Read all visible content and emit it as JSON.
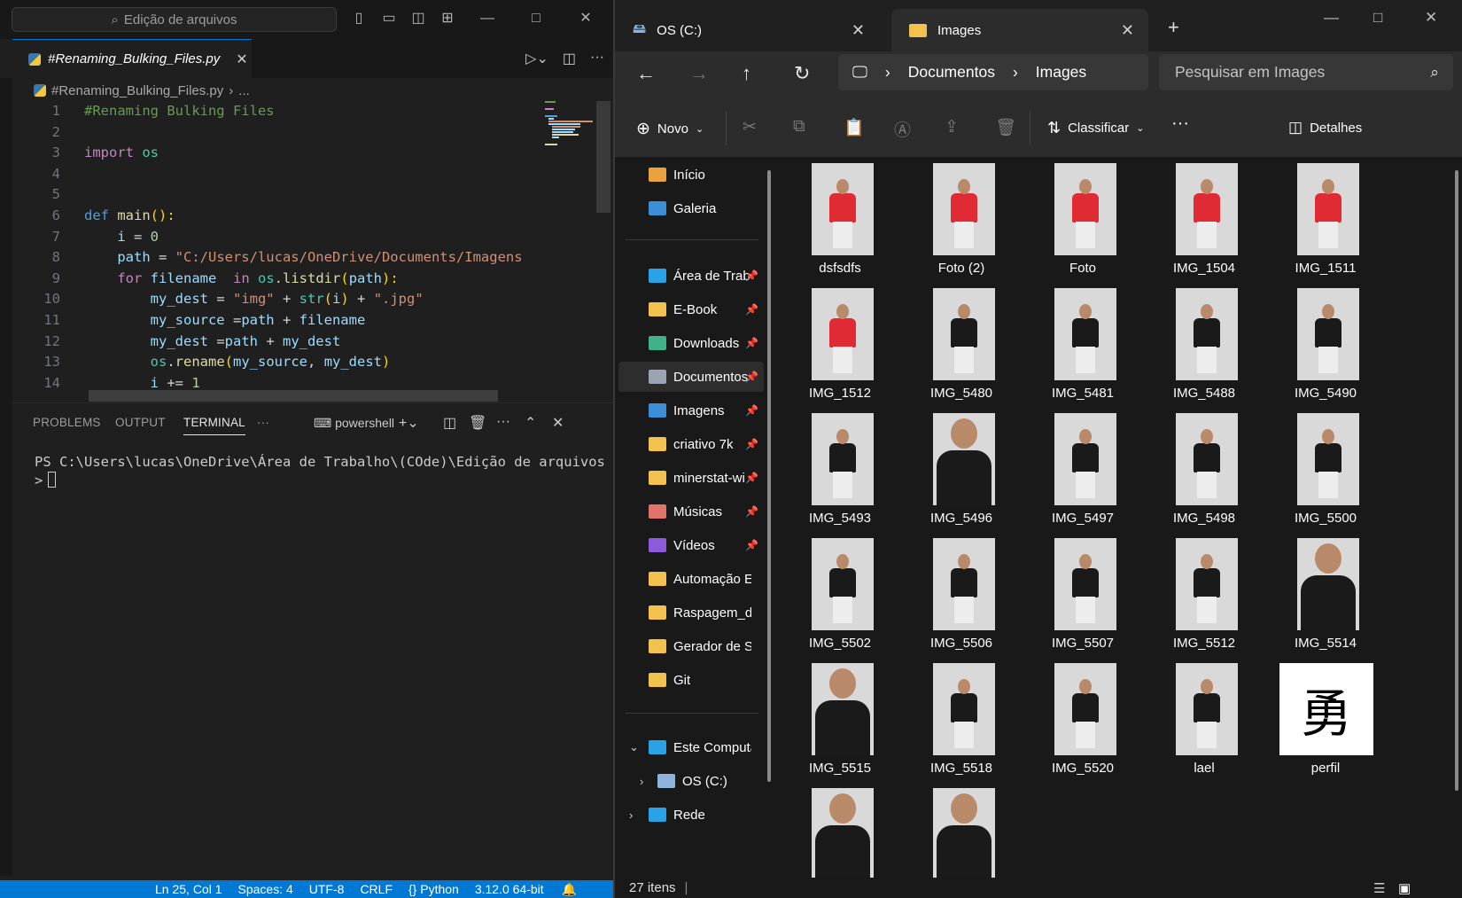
{
  "vscode": {
    "search_text": "Edição de arquivos",
    "tab_label": "#Renaming_Bulking_Files.py",
    "breadcrumb_file": "#Renaming_Bulking_Files.py",
    "breadcrumb_more": "...",
    "code_lines": [
      {
        "n": "1",
        "tokens": [
          {
            "t": "#Renaming Bulking Files",
            "c": "com"
          }
        ]
      },
      {
        "n": "2",
        "tokens": []
      },
      {
        "n": "3",
        "tokens": [
          {
            "t": "import",
            "c": "kw"
          },
          {
            "t": " os",
            "c": "mod"
          }
        ]
      },
      {
        "n": "4",
        "tokens": []
      },
      {
        "n": "5",
        "tokens": []
      },
      {
        "n": "6",
        "tokens": [
          {
            "t": "def",
            "c": "def"
          },
          {
            "t": " ",
            "c": ""
          },
          {
            "t": "main",
            "c": "fn"
          },
          {
            "t": "():",
            "c": "par"
          }
        ]
      },
      {
        "n": "7",
        "tokens": [
          {
            "t": "    i",
            "c": "var"
          },
          {
            "t": " = ",
            "c": ""
          },
          {
            "t": "0",
            "c": "num"
          }
        ]
      },
      {
        "n": "8",
        "tokens": [
          {
            "t": "    path",
            "c": "var"
          },
          {
            "t": " = ",
            "c": ""
          },
          {
            "t": "\"C:/Users/lucas/OneDrive/Documents/Imagens",
            "c": "str"
          }
        ]
      },
      {
        "n": "9",
        "tokens": [
          {
            "t": "    for",
            "c": "kw"
          },
          {
            "t": " filename",
            "c": "var"
          },
          {
            "t": "  in ",
            "c": "kw"
          },
          {
            "t": "os",
            "c": "mod"
          },
          {
            "t": ".",
            "c": ""
          },
          {
            "t": "listdir",
            "c": "fn"
          },
          {
            "t": "(",
            "c": "par"
          },
          {
            "t": "path",
            "c": "var"
          },
          {
            "t": "):",
            "c": "par"
          }
        ]
      },
      {
        "n": "10",
        "tokens": [
          {
            "t": "        my_dest",
            "c": "var"
          },
          {
            "t": " = ",
            "c": ""
          },
          {
            "t": "\"img\"",
            "c": "str"
          },
          {
            "t": " + ",
            "c": ""
          },
          {
            "t": "str",
            "c": "mod"
          },
          {
            "t": "(",
            "c": "par"
          },
          {
            "t": "i",
            "c": "var"
          },
          {
            "t": ")",
            "c": "par"
          },
          {
            "t": " + ",
            "c": ""
          },
          {
            "t": "\".jpg\"",
            "c": "str"
          }
        ]
      },
      {
        "n": "11",
        "tokens": [
          {
            "t": "        my_source",
            "c": "var"
          },
          {
            "t": " =",
            "c": ""
          },
          {
            "t": "path",
            "c": "var"
          },
          {
            "t": " + ",
            "c": ""
          },
          {
            "t": "filename",
            "c": "var"
          }
        ]
      },
      {
        "n": "12",
        "tokens": [
          {
            "t": "        my_dest",
            "c": "var"
          },
          {
            "t": " =",
            "c": ""
          },
          {
            "t": "path",
            "c": "var"
          },
          {
            "t": " + ",
            "c": ""
          },
          {
            "t": "my_dest",
            "c": "var"
          }
        ]
      },
      {
        "n": "13",
        "tokens": [
          {
            "t": "        os",
            "c": "mod"
          },
          {
            "t": ".",
            "c": ""
          },
          {
            "t": "rename",
            "c": "fn"
          },
          {
            "t": "(",
            "c": "par"
          },
          {
            "t": "my_source",
            "c": "var"
          },
          {
            "t": ", ",
            "c": ""
          },
          {
            "t": "my_dest",
            "c": "var"
          },
          {
            "t": ")",
            "c": "par"
          }
        ]
      },
      {
        "n": "14",
        "tokens": [
          {
            "t": "        i",
            "c": "var"
          },
          {
            "t": " += ",
            "c": ""
          },
          {
            "t": "1",
            "c": "num"
          }
        ]
      }
    ],
    "panel_tabs": {
      "problems": "PROBLEMS",
      "output": "OUTPUT",
      "terminal": "TERMINAL",
      "more": "···"
    },
    "shell_name": "powershell",
    "terminal_line1": "PS C:\\Users\\lucas\\OneDrive\\Área de Trabalho\\(COde)\\Edição de arquivos",
    "terminal_prompt": ">",
    "status": {
      "position": "Ln 25, Col 1",
      "spaces": "Spaces: 4",
      "encoding": "UTF-8",
      "eol": "CRLF",
      "language": "Python",
      "interpreter": "3.12.0 64-bit"
    }
  },
  "explorer": {
    "tabs": [
      {
        "label": "OS (C:)",
        "icon": "drive-icon"
      },
      {
        "label": "Images",
        "icon": "folder-icon"
      }
    ],
    "breadcrumb": [
      "Documentos",
      "Images"
    ],
    "search_placeholder": "Pesquisar em Images",
    "commands": {
      "new": "Novo",
      "sort": "Classificar",
      "more": "···",
      "details": "Detalhes"
    },
    "sidebar": [
      {
        "label": "Início",
        "icon": "home-icon",
        "color": "#e8a33d",
        "pin": false
      },
      {
        "label": "Galeria",
        "icon": "gallery-icon",
        "color": "#3a8fd6",
        "pin": false
      },
      {
        "label": "Área de Trab",
        "icon": "desktop-icon",
        "color": "#2aa3e6",
        "pin": true
      },
      {
        "label": "E-Book",
        "icon": "folder-icon",
        "color": "#f2c14e",
        "pin": true
      },
      {
        "label": "Downloads",
        "icon": "download-icon",
        "color": "#3fb28a",
        "pin": true
      },
      {
        "label": "Documentos",
        "icon": "document-icon",
        "color": "#9aa4b2",
        "pin": true
      },
      {
        "label": "Imagens",
        "icon": "pictures-icon",
        "color": "#3a8fd6",
        "pin": true
      },
      {
        "label": "criativo 7k",
        "icon": "folder-icon",
        "color": "#f2c14e",
        "pin": true
      },
      {
        "label": "minerstat-wi",
        "icon": "folder-icon",
        "color": "#f2c14e",
        "pin": true
      },
      {
        "label": "Músicas",
        "icon": "music-icon",
        "color": "#e0746a",
        "pin": true
      },
      {
        "label": "Vídeos",
        "icon": "video-icon",
        "color": "#8c5bd9",
        "pin": true
      },
      {
        "label": "Automação E-m",
        "icon": "folder-icon",
        "color": "#f2c14e",
        "pin": false
      },
      {
        "label": "Raspagem_de_[",
        "icon": "folder-icon",
        "color": "#f2c14e",
        "pin": false
      },
      {
        "label": "Gerador de Sen",
        "icon": "folder-icon",
        "color": "#f2c14e",
        "pin": false
      },
      {
        "label": "Git",
        "icon": "folder-icon",
        "color": "#f2c14e",
        "pin": false
      },
      {
        "label": "Este Computad",
        "icon": "computer-icon",
        "color": "#2aa3e6",
        "pin": false
      },
      {
        "label": "OS (C:)",
        "icon": "drive-icon",
        "color": "#8fb4d9",
        "pin": false
      },
      {
        "label": "Rede",
        "icon": "network-icon",
        "color": "#2aa3e6",
        "pin": false
      }
    ],
    "files": [
      {
        "name": "dsfsdfs",
        "shirt": "#e02b35",
        "close": false
      },
      {
        "name": "Foto (2)",
        "shirt": "#e02b35",
        "close": false
      },
      {
        "name": "Foto",
        "shirt": "#e02b35",
        "close": false
      },
      {
        "name": "IMG_1504",
        "shirt": "#e02b35",
        "close": false
      },
      {
        "name": "IMG_1511",
        "shirt": "#e02b35",
        "close": false
      },
      {
        "name": "IMG_1512",
        "shirt": "#e02b35",
        "close": false
      },
      {
        "name": "IMG_5480",
        "shirt": "#1a1a1a",
        "close": false
      },
      {
        "name": "IMG_5481",
        "shirt": "#1a1a1a",
        "close": false
      },
      {
        "name": "IMG_5488",
        "shirt": "#1a1a1a",
        "close": false
      },
      {
        "name": "IMG_5490",
        "shirt": "#1a1a1a",
        "close": false
      },
      {
        "name": "IMG_5493",
        "shirt": "#1a1a1a",
        "close": false
      },
      {
        "name": "IMG_5496",
        "shirt": "#1a1a1a",
        "close": true
      },
      {
        "name": "IMG_5497",
        "shirt": "#1a1a1a",
        "close": false
      },
      {
        "name": "IMG_5498",
        "shirt": "#1a1a1a",
        "close": false
      },
      {
        "name": "IMG_5500",
        "shirt": "#1a1a1a",
        "close": false
      },
      {
        "name": "IMG_5502",
        "shirt": "#1a1a1a",
        "close": false
      },
      {
        "name": "IMG_5506",
        "shirt": "#1a1a1a",
        "close": false
      },
      {
        "name": "IMG_5507",
        "shirt": "#1a1a1a",
        "close": false
      },
      {
        "name": "IMG_5512",
        "shirt": "#1a1a1a",
        "close": false
      },
      {
        "name": "IMG_5514",
        "shirt": "#1a1a1a",
        "close": true
      },
      {
        "name": "IMG_5515",
        "shirt": "#1a1a1a",
        "close": true
      },
      {
        "name": "IMG_5518",
        "shirt": "#1a1a1a",
        "close": false
      },
      {
        "name": "IMG_5520",
        "shirt": "#1a1a1a",
        "close": false
      },
      {
        "name": "lael",
        "shirt": "#1a1a1a",
        "close": false
      },
      {
        "name": "perfil",
        "glyph": "勇"
      },
      {
        "name": "",
        "shirt": "#1a1a1a",
        "close": true
      },
      {
        "name": "",
        "shirt": "#1a1a1a",
        "close": true
      }
    ],
    "item_count": "27 itens"
  }
}
